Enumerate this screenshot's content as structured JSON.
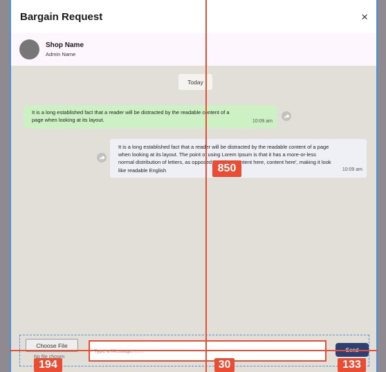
{
  "modal": {
    "title": "Bargain Request",
    "close_label": "×"
  },
  "shop": {
    "name": "Shop Name",
    "admin": "Admin Name"
  },
  "chat": {
    "date_label": "Today",
    "messages": [
      {
        "text": "It is a long established fact that a reader will be distracted by the readable content of a page when looking at its layout.",
        "time": "10:09 am"
      },
      {
        "text": "It is a long established fact that a reader will be distracted by the readable content of a page when looking at its layout. The point of using Lorem Ipsum is that it has a more-or-less normal distribution of letters, as opposed to using 'Content here, content here', making it look like readable English",
        "time": "10:09 am"
      }
    ]
  },
  "composer": {
    "choose_file_label": "Choose File",
    "no_file_label": "No file chosen",
    "message_placeholder": "Type a Message........",
    "send_label": "Send"
  },
  "markers": [
    "850",
    "194",
    "30",
    "133"
  ],
  "colors": {
    "accent": "#e94e35",
    "send": "#2e3f72",
    "incoming": "#cdf0c4",
    "outgoing": "#eef0f5"
  }
}
